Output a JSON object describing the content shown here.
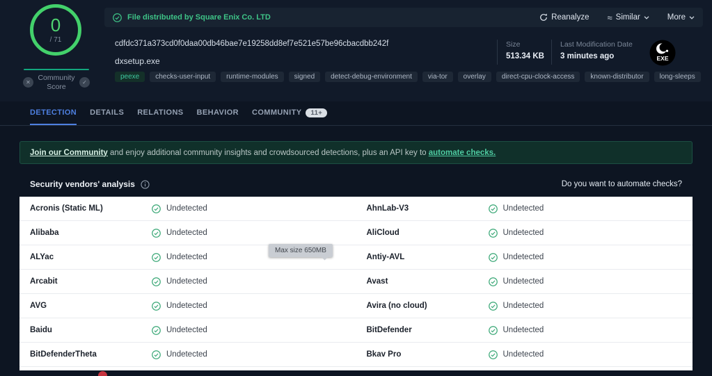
{
  "colors": {
    "score_green": "#43d16b",
    "tab_active_blue": "#4e80e1",
    "undetected_green": "#3ba877",
    "notice_green": "#3ec487",
    "banner_link_green": "#4ecba1"
  },
  "icons": {
    "downvote": "✕",
    "upvote": "✓",
    "similar": "≈"
  },
  "header": {
    "gauge": {
      "score": "0",
      "total": "/ 71"
    },
    "community": {
      "label": "Community Score"
    },
    "notice": "File distributed by Square Enix Co. LTD",
    "actions": {
      "reanalyze": "Reanalyze",
      "similar": "Similar",
      "more": "More"
    },
    "file": {
      "hash": "cdfdc371a373cd0f0daa00db46bae7e19258dd8ef7e521e57be96cbacdbb242f",
      "name": "dxsetup.exe"
    },
    "meta": {
      "size_label": "Size",
      "size_value": "513.34 KB",
      "mod_label": "Last Modification Date",
      "mod_value": "3 minutes ago"
    },
    "type_badge": "EXE",
    "tags": [
      "peexe",
      "checks-user-input",
      "runtime-modules",
      "signed",
      "detect-debug-environment",
      "via-tor",
      "overlay",
      "direct-cpu-clock-access",
      "known-distributor",
      "long-sleeps"
    ]
  },
  "tabs": [
    {
      "label": "DETECTION"
    },
    {
      "label": "DETAILS"
    },
    {
      "label": "RELATIONS"
    },
    {
      "label": "BEHAVIOR"
    },
    {
      "label": "COMMUNITY",
      "badge": "11+"
    }
  ],
  "banner": {
    "link1": "Join our Community",
    "middle": " and enjoy additional community insights and crowdsourced detections, plus an API key to ",
    "link2": "automate checks."
  },
  "analysis": {
    "title": "Security vendors' analysis",
    "automate_link": "Do you want to automate checks?",
    "status_label": "Undetected",
    "rows": [
      [
        "Acronis (Static ML)",
        "AhnLab-V3"
      ],
      [
        "Alibaba",
        "AliCloud"
      ],
      [
        "ALYac",
        "Antiy-AVL"
      ],
      [
        "Arcabit",
        "Avast"
      ],
      [
        "AVG",
        "Avira (no cloud)"
      ],
      [
        "Baidu",
        "BitDefender"
      ],
      [
        "BitDefenderTheta",
        "Bkav Pro"
      ]
    ]
  },
  "tooltip": "Max size 650MB"
}
